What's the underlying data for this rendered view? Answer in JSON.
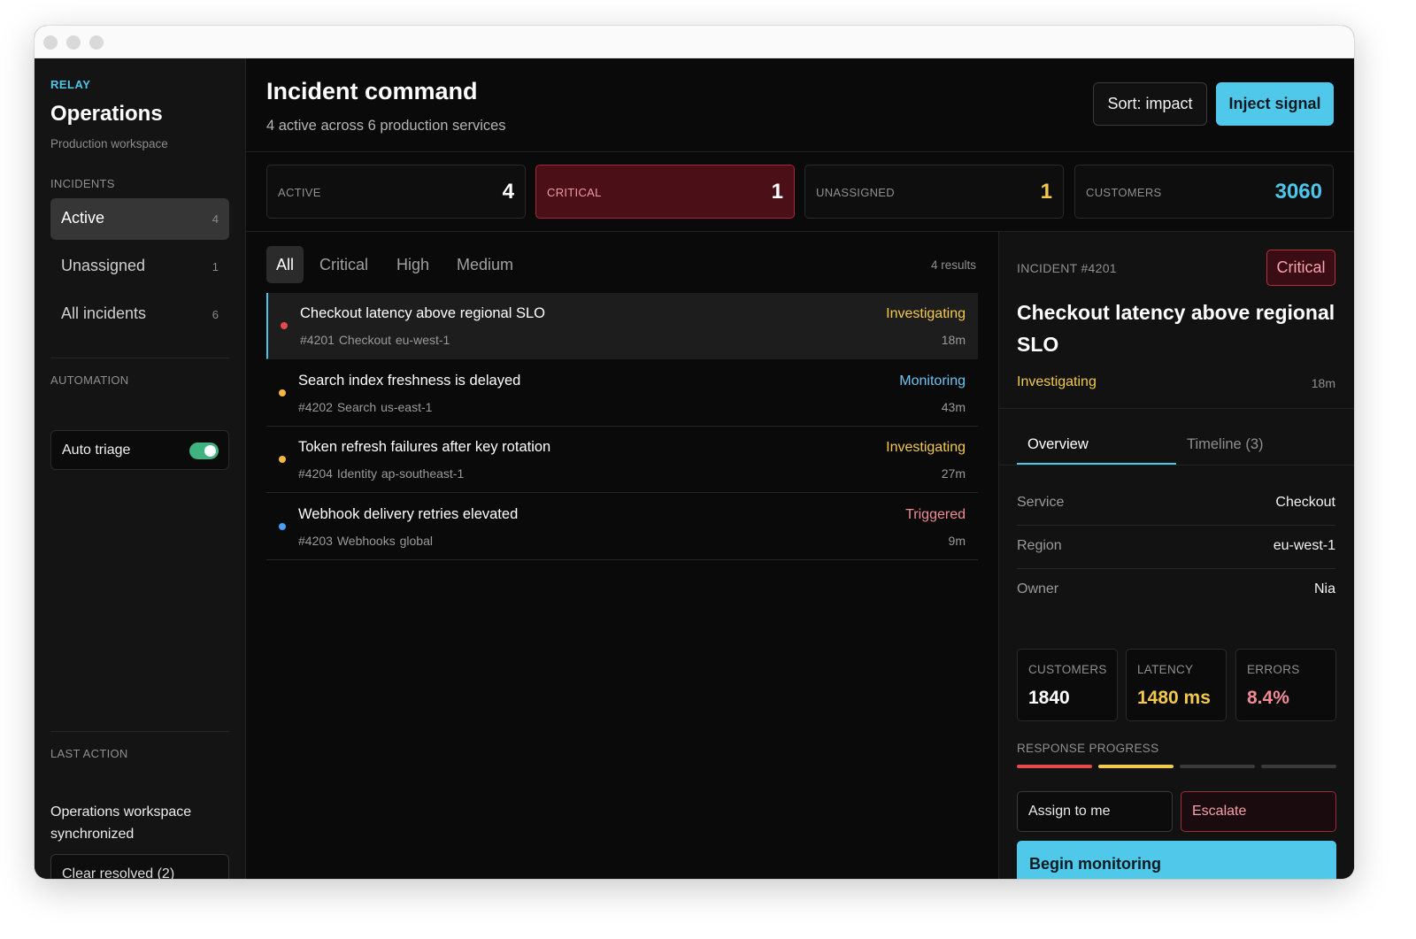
{
  "sidebar": {
    "brand": "RELAY",
    "title": "Operations",
    "subtitle": "Production workspace",
    "incidents_label": "INCIDENTS",
    "nav": [
      {
        "label": "Active",
        "count": "4"
      },
      {
        "label": "Unassigned",
        "count": "1"
      },
      {
        "label": "All incidents",
        "count": "6"
      }
    ],
    "automation_label": "AUTOMATION",
    "auto_triage": {
      "label": "Auto triage",
      "enabled": true
    },
    "last_action_label": "LAST ACTION",
    "last_action_text": "Operations workspace synchronized",
    "clear_button": "Clear resolved (2)"
  },
  "header": {
    "title": "Incident command",
    "subtitle": "4 active across 6 production services",
    "sort_button": "Sort: impact",
    "inject_button": "Inject signal"
  },
  "stats": [
    {
      "label": "ACTIVE",
      "value": "4",
      "color": "#ffffff"
    },
    {
      "label": "CRITICAL",
      "value": "1",
      "color": "#ffffff"
    },
    {
      "label": "UNASSIGNED",
      "value": "1",
      "color": "#f2c94c"
    },
    {
      "label": "CUSTOMERS",
      "value": "3060",
      "color": "#4cc7ea"
    }
  ],
  "filters": {
    "tabs": [
      "All",
      "Critical",
      "High",
      "Medium"
    ],
    "active": "All",
    "results": "4 results"
  },
  "incidents": [
    {
      "title": "Checkout latency above regional SLO",
      "meta": "#4201  Checkout  eu-west-1",
      "status": "Investigating",
      "age": "18m",
      "dot": "#e5484d",
      "status_color": "#f2c94c"
    },
    {
      "title": "Search index freshness is delayed",
      "meta": "#4202  Search  us-east-1",
      "status": "Monitoring",
      "age": "43m",
      "dot": "#f5b73b",
      "status_color": "#6cc4f0"
    },
    {
      "title": "Token refresh failures after key rotation",
      "meta": "#4204  Identity  ap-southeast-1",
      "status": "Investigating",
      "age": "27m",
      "dot": "#f5b73b",
      "status_color": "#f2c94c"
    },
    {
      "title": "Webhook delivery retries elevated",
      "meta": "#4203  Webhooks  global",
      "status": "Triggered",
      "age": "9m",
      "dot": "#4a9ff5",
      "status_color": "#f28a96"
    }
  ],
  "detail": {
    "id": "INCIDENT #4201",
    "badge": "Critical",
    "title": "Checkout latency above regional SLO",
    "status": "Investigating",
    "age": "18m",
    "tabs": [
      "Overview",
      "Timeline (3)"
    ],
    "fields": [
      {
        "key": "Service",
        "value": "Checkout"
      },
      {
        "key": "Region",
        "value": "eu-west-1"
      },
      {
        "key": "Owner",
        "value": "Nia"
      }
    ],
    "metrics": [
      {
        "label": "CUSTOMERS",
        "value": "1840",
        "color": "#ffffff"
      },
      {
        "label": "LATENCY",
        "value": "1480 ms",
        "color": "#f2c94c"
      },
      {
        "label": "ERRORS",
        "value": "8.4%",
        "color": "#f28a96"
      }
    ],
    "progress_label": "RESPONSE PROGRESS",
    "progress_steps": [
      {
        "state": "done",
        "color": "#e5484d"
      },
      {
        "state": "current",
        "color": "#f2c94c"
      },
      {
        "state": "pending",
        "color": "#3a3a3a"
      },
      {
        "state": "pending",
        "color": "#3a3a3a"
      }
    ],
    "assign_button": "Assign to me",
    "escalate_button": "Escalate",
    "begin_button": "Begin monitoring"
  }
}
